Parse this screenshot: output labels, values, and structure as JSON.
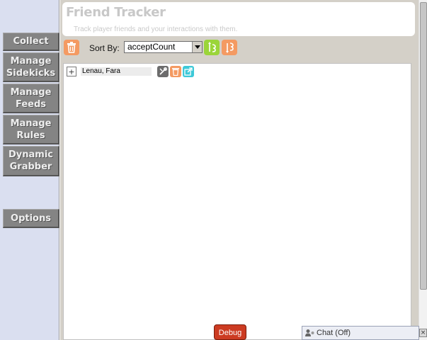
{
  "sidebar": {
    "items": [
      {
        "lines": [
          "Collect"
        ]
      },
      {
        "lines": [
          "Manage",
          "Sidekicks"
        ]
      },
      {
        "lines": [
          "Manage",
          "Feeds"
        ]
      },
      {
        "lines": [
          "Manage",
          "Rules"
        ]
      },
      {
        "lines": [
          "Dynamic",
          "Grabber"
        ]
      },
      {
        "lines": [
          "Options"
        ]
      }
    ]
  },
  "header": {
    "title": "Friend Tracker",
    "subtitle": "Track player friends and your interactions with them."
  },
  "toolbar": {
    "sort_label": "Sort By:",
    "sort_value": "acceptCount"
  },
  "friends": [
    {
      "name": "Lenau, Fara"
    }
  ],
  "footer": {
    "debug_label": "Debug",
    "chat_label": "Chat (Off)"
  },
  "colors": {
    "accent_orange": "#f49a62",
    "accent_green": "#9bd53a",
    "accent_teal": "#3ec9d8",
    "debug_red": "#cc3b22"
  }
}
